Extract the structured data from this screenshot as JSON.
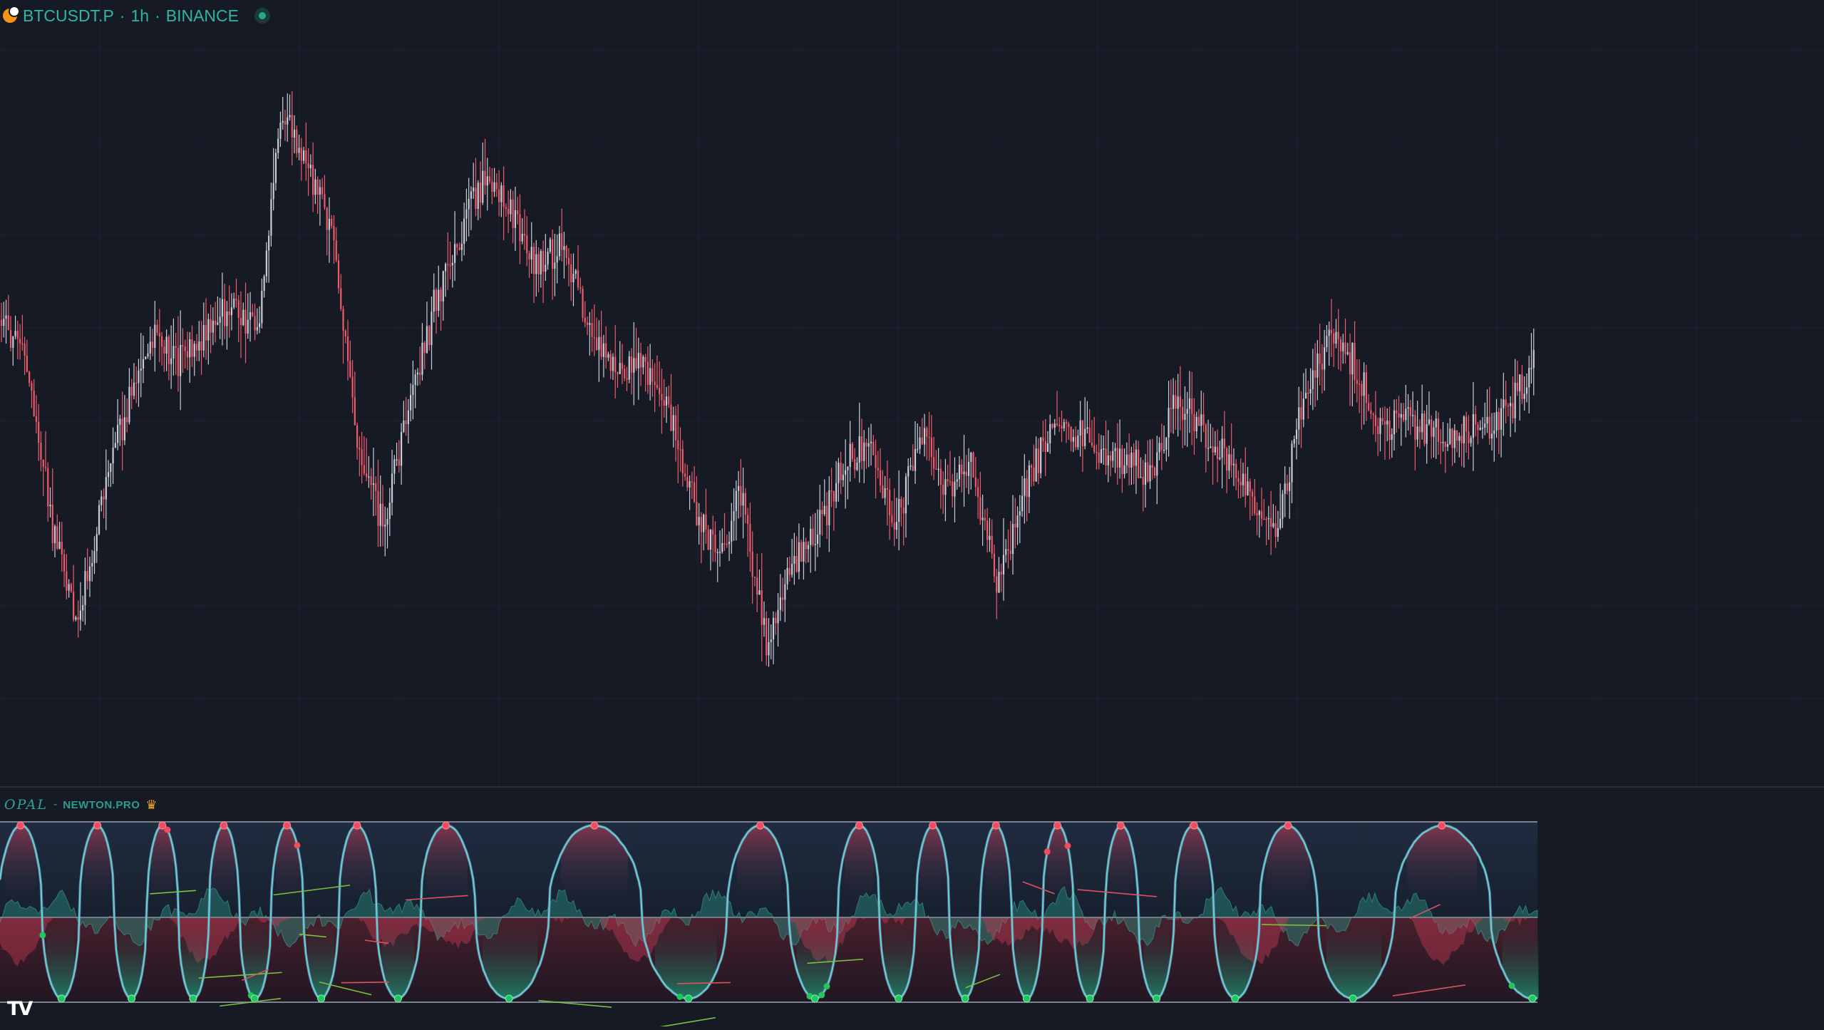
{
  "header": {
    "symbol": "BTCUSDT.P",
    "interval": "1h",
    "exchange": "BINANCE",
    "separator": "·"
  },
  "indicator": {
    "name": "OPAL",
    "separator": "-",
    "vendor": "NEWTON.PRO",
    "badge_icon": "crown-icon"
  },
  "branding": {
    "logo_text": "TV",
    "logo_icon": "tradingview-logo"
  },
  "colors": {
    "background": "#161a25",
    "grid": "#1e2230",
    "up_candle": "#c9ced8",
    "down_candle": "#ef5b6b",
    "teal": "#2fb7a1",
    "red": "#ef4d5f",
    "green_dot": "#22c55e",
    "band_line": "#7a8190",
    "oscillator": "#5fd4c8"
  },
  "chart_data": {
    "type": "candlestick",
    "series": [
      {
        "name": "BTCUSDT.P",
        "close_shape": [
          0.62,
          0.55,
          0.3,
          0.15,
          0.35,
          0.5,
          0.6,
          0.55,
          0.6,
          0.65,
          0.6,
          0.95,
          0.85,
          0.75,
          0.4,
          0.3,
          0.5,
          0.65,
          0.75,
          0.85,
          0.78,
          0.7,
          0.75,
          0.6,
          0.55,
          0.55,
          0.5,
          0.35,
          0.25,
          0.35,
          0.1,
          0.25,
          0.3,
          0.4,
          0.42,
          0.3,
          0.45,
          0.35,
          0.4,
          0.2,
          0.35,
          0.45,
          0.45,
          0.42,
          0.4,
          0.38,
          0.5,
          0.45,
          0.4,
          0.35,
          0.3,
          0.5,
          0.6,
          0.55,
          0.45,
          0.46,
          0.44,
          0.45,
          0.45,
          0.48,
          0.55
        ]
      }
    ]
  }
}
